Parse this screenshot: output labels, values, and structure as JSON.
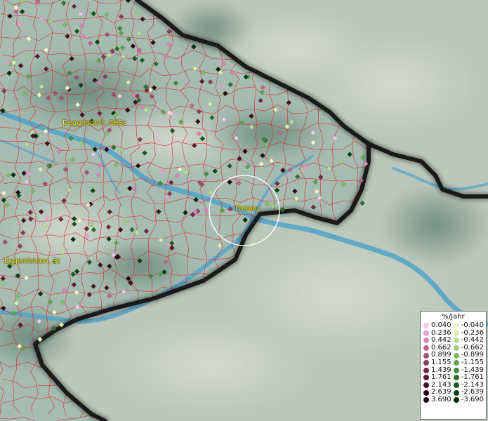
{
  "map": {
    "labels": {
      "deggendorf": "Deggendorf, GKSt",
      "passau": "Passau",
      "eggenfelden": "Eggenfelden, St"
    },
    "colors": {
      "terrain_light": "#b7c7bd",
      "terrain_dark": "#7d9a8e",
      "river": "#4fa3c7",
      "border": "#1a1a1a",
      "municipal_lines": "#e0202a",
      "highlight_circle": "#ffffff",
      "label_text": "#f2e600"
    }
  },
  "legend": {
    "title": "%/Jahr",
    "positive": [
      {
        "label": "0.040",
        "color": "#f7c6ec"
      },
      {
        "label": "0.236",
        "color": "#e9a3d3"
      },
      {
        "label": "0.442",
        "color": "#d884b6"
      },
      {
        "label": "0.662",
        "color": "#c0658f"
      },
      {
        "label": "0.899",
        "color": "#a64d72"
      },
      {
        "label": "1.155",
        "color": "#8c3a58"
      },
      {
        "label": "1.439",
        "color": "#742843"
      },
      {
        "label": "1.761",
        "color": "#5d1a30"
      },
      {
        "label": "2.143",
        "color": "#471022"
      },
      {
        "label": "2.639",
        "color": "#300815"
      },
      {
        "label": "3.690",
        "color": "#1c0309"
      }
    ],
    "negative": [
      {
        "label": "-0.040",
        "color": "#f7f7c0"
      },
      {
        "label": "-0.236",
        "color": "#dcefa8"
      },
      {
        "label": "-0.442",
        "color": "#bfe08e"
      },
      {
        "label": "-0.662",
        "color": "#9fcf76"
      },
      {
        "label": "-0.899",
        "color": "#7fbb60"
      },
      {
        "label": "-1.155",
        "color": "#5ea54a"
      },
      {
        "label": "-1.439",
        "color": "#3f8c36"
      },
      {
        "label": "-1.761",
        "color": "#287227"
      },
      {
        "label": "-2.143",
        "color": "#165a1a"
      },
      {
        "label": "-2.639",
        "color": "#0b4110"
      },
      {
        "label": "-3.690",
        "color": "#042a08"
      }
    ]
  }
}
